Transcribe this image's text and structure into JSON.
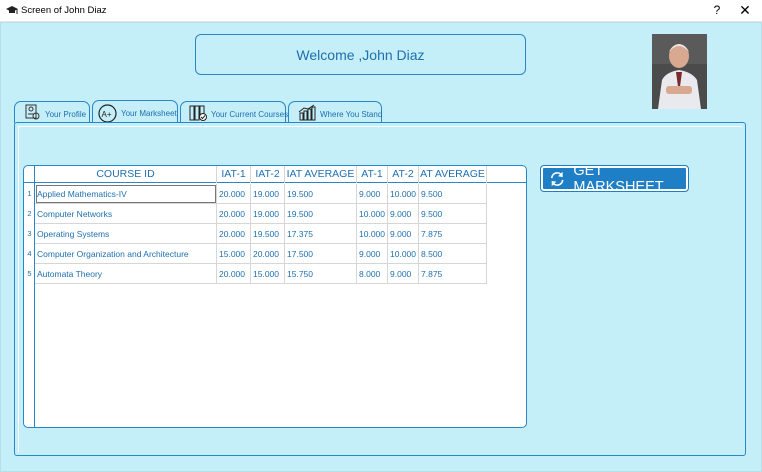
{
  "window": {
    "title": "Screen of John Diaz",
    "help_label": "?",
    "close_label": "✕"
  },
  "welcome_text": "Welcome ,John Diaz",
  "tabs": [
    {
      "label": "Your Profile",
      "icon": "profile-icon"
    },
    {
      "label": "Your Marksheet",
      "icon": "marksheet-icon"
    },
    {
      "label": "Your Current Courses",
      "icon": "courses-icon"
    },
    {
      "label": "Where You Stand",
      "icon": "chart-icon"
    }
  ],
  "get_button_label": "GET MARKSHEET",
  "table": {
    "columns": [
      "COURSE ID",
      "IAT-1",
      "IAT-2",
      "IAT AVERAGE",
      "AT-1",
      "AT-2",
      "AT AVERAGE"
    ],
    "rows": [
      {
        "num": "1",
        "cells": [
          "Applied Mathematics-IV",
          "20.000",
          "19.000",
          "19.500",
          "9.000",
          "10.000",
          "9.500"
        ]
      },
      {
        "num": "2",
        "cells": [
          "Computer Networks",
          "20.000",
          "19.000",
          "19.500",
          "10.000",
          "9.000",
          "9.500"
        ]
      },
      {
        "num": "3",
        "cells": [
          "Operating Systems",
          "20.000",
          "19.500",
          "17.375",
          "10.000",
          "9.000",
          "7.875"
        ]
      },
      {
        "num": "4",
        "cells": [
          "Computer Organization and Architecture",
          "15.000",
          "20.000",
          "17.500",
          "9.000",
          "10.000",
          "8.500"
        ]
      },
      {
        "num": "5",
        "cells": [
          "Automata Theory",
          "20.000",
          "15.000",
          "15.750",
          "8.000",
          "9.000",
          "7.875"
        ]
      }
    ]
  },
  "colors": {
    "background": "#c4eef8",
    "accent": "#1f7fc6",
    "text": "#1e6fb0"
  }
}
